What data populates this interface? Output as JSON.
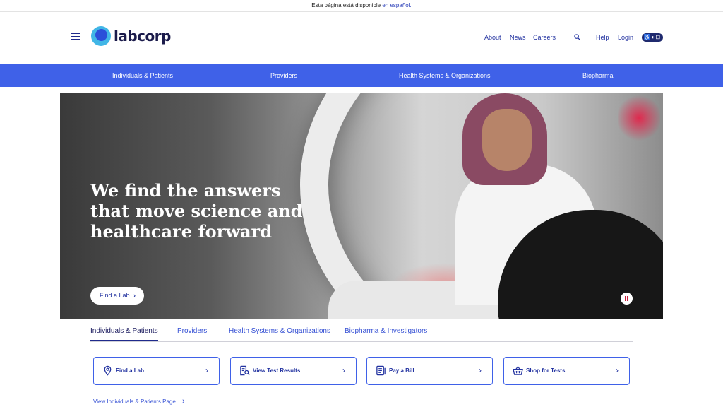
{
  "top_banner": {
    "text": "Esta página está disponible",
    "link": "en español."
  },
  "header": {
    "logo_text": "labcorp",
    "utility_links": {
      "about": "About",
      "news": "News",
      "careers": "Careers",
      "help": "Help",
      "login": "Login"
    },
    "accessibility_label": "♿◐⊟"
  },
  "nav": {
    "items": [
      "Individuals & Patients",
      "Providers",
      "Health Systems & Organizations",
      "Biopharma"
    ]
  },
  "hero": {
    "title": "We find the answers that move science and healthcare forward",
    "cta": "Find a Lab",
    "cta_chevron": "›"
  },
  "audience_tabs": {
    "items": [
      "Individuals & Patients",
      "Providers",
      "Health Systems & Organizations",
      "Biopharma & Investigators"
    ],
    "active": "Individuals & Patients"
  },
  "quick_actions": [
    {
      "label": "Find a Lab",
      "icon": "location-pin-icon"
    },
    {
      "label": "View Test Results",
      "icon": "document-search-icon"
    },
    {
      "label": "Pay a Bill",
      "icon": "bill-icon"
    },
    {
      "label": "Shop for Tests",
      "icon": "shopping-basket-icon"
    }
  ],
  "view_page_link": "View Individuals & Patients Page",
  "colors": {
    "brand_blue": "#3f61e8",
    "navy": "#1a1a5e",
    "logo_cyan": "#41b6e6"
  }
}
